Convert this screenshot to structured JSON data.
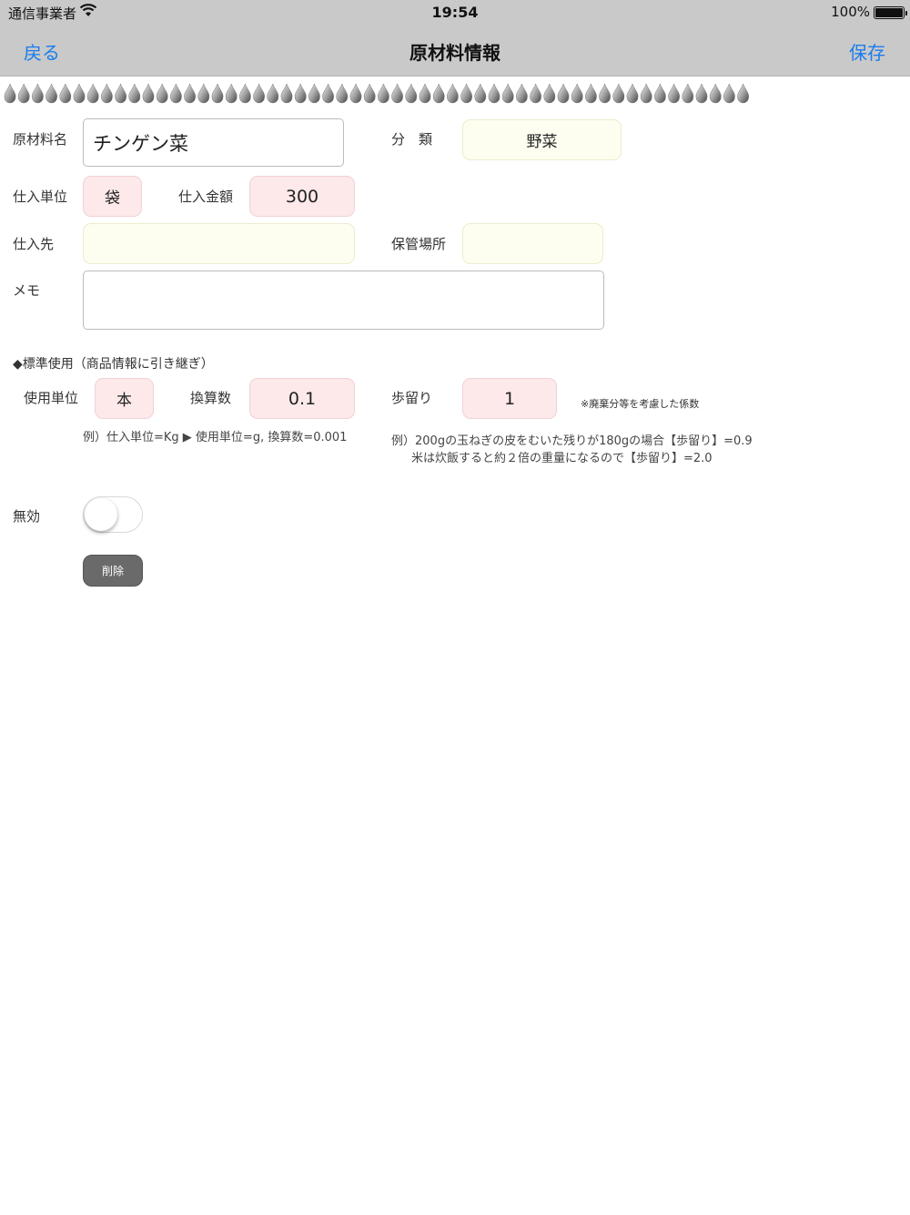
{
  "status_bar": {
    "carrier": "通信事業者",
    "time": "19:54",
    "battery": "100%"
  },
  "nav": {
    "back": "戻る",
    "title": "原材料情報",
    "save": "保存"
  },
  "form": {
    "name_label": "原材料名",
    "name_value": "チンゲン菜",
    "category_label": "分　類",
    "category_value": "野菜",
    "purchase_unit_label": "仕入単位",
    "purchase_unit_value": "袋",
    "purchase_price_label": "仕入金額",
    "purchase_price_value": "300",
    "supplier_label": "仕入先",
    "supplier_value": "",
    "storage_label": "保管場所",
    "storage_value": "",
    "memo_label": "メモ",
    "memo_value": ""
  },
  "standard": {
    "heading": "◆標準使用（商品情報に引き継ぎ）",
    "use_unit_label": "使用単位",
    "use_unit_value": "本",
    "conversion_label": "換算数",
    "conversion_value": "0.1",
    "yield_label": "歩留り",
    "yield_value": "1",
    "yield_note": "※廃棄分等を考慮した係数",
    "example_unit": "例）仕入単位=Kg ▶ 使用単位=g, 換算数=0.001",
    "example_yield_1": "例）200gの玉ねぎの皮をむいた残りが180gの場合【歩留り】=0.9",
    "example_yield_2": "米は炊飯すると約２倍の重量になるので【歩留り】=2.0"
  },
  "disabled": {
    "label": "無効",
    "on": false
  },
  "delete_label": "削除",
  "colors": {
    "nav_bg": "#c9c9c9",
    "accent": "#1a7cf0",
    "pink_field": "#fde9ea",
    "cream_field": "#fefef0",
    "delete_bg": "#6a6a6a"
  },
  "icons": {
    "wifi": "wifi-icon",
    "battery": "battery-icon",
    "drops": "drop-icon"
  }
}
